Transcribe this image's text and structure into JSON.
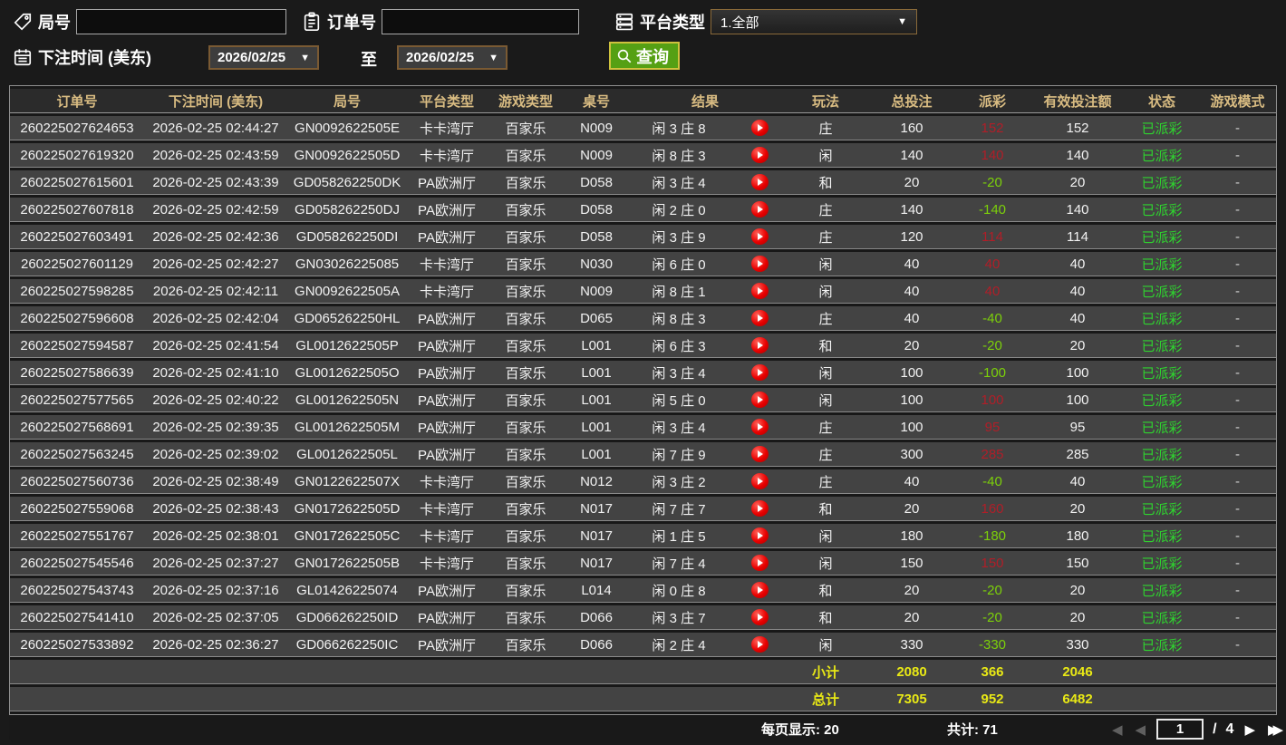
{
  "filters": {
    "game_no_label": "局号",
    "order_no_label": "订单号",
    "platform_label": "平台类型",
    "platform_value": "1.全部",
    "bet_time_label": "下注时间 (美东)",
    "date_from": "2026/02/25",
    "date_to": "2026/02/25",
    "to_label": "至",
    "search_label": "查询",
    "dropdown_arrow": "▼"
  },
  "table": {
    "headers": [
      "订单号",
      "下注时间 (美东)",
      "局号",
      "平台类型",
      "游戏类型",
      "桌号",
      "结果",
      "玩法",
      "总投注",
      "派彩",
      "有效投注额",
      "状态",
      "游戏模式"
    ],
    "rows": [
      {
        "order_no": "260225027624653",
        "bet_time": "2026-02-25 02:44:27",
        "game_no": "GN0092622505E",
        "platform": "卡卡湾厅",
        "game_type": "百家乐",
        "table_no": "N009",
        "result": "闲 3 庄 8",
        "method": "庄",
        "total_bet": "160",
        "payout": "152",
        "valid_bet": "152",
        "status": "已派彩",
        "mode": "-"
      },
      {
        "order_no": "260225027619320",
        "bet_time": "2026-02-25 02:43:59",
        "game_no": "GN0092622505D",
        "platform": "卡卡湾厅",
        "game_type": "百家乐",
        "table_no": "N009",
        "result": "闲 8 庄 3",
        "method": "闲",
        "total_bet": "140",
        "payout": "140",
        "valid_bet": "140",
        "status": "已派彩",
        "mode": "-"
      },
      {
        "order_no": "260225027615601",
        "bet_time": "2026-02-25 02:43:39",
        "game_no": "GD058262250DK",
        "platform": "PA欧洲厅",
        "game_type": "百家乐",
        "table_no": "D058",
        "result": "闲 3 庄 4",
        "method": "和",
        "total_bet": "20",
        "payout": "-20",
        "valid_bet": "20",
        "status": "已派彩",
        "mode": "-"
      },
      {
        "order_no": "260225027607818",
        "bet_time": "2026-02-25 02:42:59",
        "game_no": "GD058262250DJ",
        "platform": "PA欧洲厅",
        "game_type": "百家乐",
        "table_no": "D058",
        "result": "闲 2 庄 0",
        "method": "庄",
        "total_bet": "140",
        "payout": "-140",
        "valid_bet": "140",
        "status": "已派彩",
        "mode": "-"
      },
      {
        "order_no": "260225027603491",
        "bet_time": "2026-02-25 02:42:36",
        "game_no": "GD058262250DI",
        "platform": "PA欧洲厅",
        "game_type": "百家乐",
        "table_no": "D058",
        "result": "闲 3 庄 9",
        "method": "庄",
        "total_bet": "120",
        "payout": "114",
        "valid_bet": "114",
        "status": "已派彩",
        "mode": "-"
      },
      {
        "order_no": "260225027601129",
        "bet_time": "2026-02-25 02:42:27",
        "game_no": "GN03026225085",
        "platform": "卡卡湾厅",
        "game_type": "百家乐",
        "table_no": "N030",
        "result": "闲 6 庄 0",
        "method": "闲",
        "total_bet": "40",
        "payout": "40",
        "valid_bet": "40",
        "status": "已派彩",
        "mode": "-"
      },
      {
        "order_no": "260225027598285",
        "bet_time": "2026-02-25 02:42:11",
        "game_no": "GN0092622505A",
        "platform": "卡卡湾厅",
        "game_type": "百家乐",
        "table_no": "N009",
        "result": "闲 8 庄 1",
        "method": "闲",
        "total_bet": "40",
        "payout": "40",
        "valid_bet": "40",
        "status": "已派彩",
        "mode": "-"
      },
      {
        "order_no": "260225027596608",
        "bet_time": "2026-02-25 02:42:04",
        "game_no": "GD065262250HL",
        "platform": "PA欧洲厅",
        "game_type": "百家乐",
        "table_no": "D065",
        "result": "闲 8 庄 3",
        "method": "庄",
        "total_bet": "40",
        "payout": "-40",
        "valid_bet": "40",
        "status": "已派彩",
        "mode": "-"
      },
      {
        "order_no": "260225027594587",
        "bet_time": "2026-02-25 02:41:54",
        "game_no": "GL0012622505P",
        "platform": "PA欧洲厅",
        "game_type": "百家乐",
        "table_no": "L001",
        "result": "闲 6 庄 3",
        "method": "和",
        "total_bet": "20",
        "payout": "-20",
        "valid_bet": "20",
        "status": "已派彩",
        "mode": "-"
      },
      {
        "order_no": "260225027586639",
        "bet_time": "2026-02-25 02:41:10",
        "game_no": "GL0012622505O",
        "platform": "PA欧洲厅",
        "game_type": "百家乐",
        "table_no": "L001",
        "result": "闲 3 庄 4",
        "method": "闲",
        "total_bet": "100",
        "payout": "-100",
        "valid_bet": "100",
        "status": "已派彩",
        "mode": "-"
      },
      {
        "order_no": "260225027577565",
        "bet_time": "2026-02-25 02:40:22",
        "game_no": "GL0012622505N",
        "platform": "PA欧洲厅",
        "game_type": "百家乐",
        "table_no": "L001",
        "result": "闲 5 庄 0",
        "method": "闲",
        "total_bet": "100",
        "payout": "100",
        "valid_bet": "100",
        "status": "已派彩",
        "mode": "-"
      },
      {
        "order_no": "260225027568691",
        "bet_time": "2026-02-25 02:39:35",
        "game_no": "GL0012622505M",
        "platform": "PA欧洲厅",
        "game_type": "百家乐",
        "table_no": "L001",
        "result": "闲 3 庄 4",
        "method": "庄",
        "total_bet": "100",
        "payout": "95",
        "valid_bet": "95",
        "status": "已派彩",
        "mode": "-"
      },
      {
        "order_no": "260225027563245",
        "bet_time": "2026-02-25 02:39:02",
        "game_no": "GL0012622505L",
        "platform": "PA欧洲厅",
        "game_type": "百家乐",
        "table_no": "L001",
        "result": "闲 7 庄 9",
        "method": "庄",
        "total_bet": "300",
        "payout": "285",
        "valid_bet": "285",
        "status": "已派彩",
        "mode": "-"
      },
      {
        "order_no": "260225027560736",
        "bet_time": "2026-02-25 02:38:49",
        "game_no": "GN0122622507X",
        "platform": "卡卡湾厅",
        "game_type": "百家乐",
        "table_no": "N012",
        "result": "闲 3 庄 2",
        "method": "庄",
        "total_bet": "40",
        "payout": "-40",
        "valid_bet": "40",
        "status": "已派彩",
        "mode": "-"
      },
      {
        "order_no": "260225027559068",
        "bet_time": "2026-02-25 02:38:43",
        "game_no": "GN0172622505D",
        "platform": "卡卡湾厅",
        "game_type": "百家乐",
        "table_no": "N017",
        "result": "闲 7 庄 7",
        "method": "和",
        "total_bet": "20",
        "payout": "160",
        "valid_bet": "20",
        "status": "已派彩",
        "mode": "-"
      },
      {
        "order_no": "260225027551767",
        "bet_time": "2026-02-25 02:38:01",
        "game_no": "GN0172622505C",
        "platform": "卡卡湾厅",
        "game_type": "百家乐",
        "table_no": "N017",
        "result": "闲 1 庄 5",
        "method": "闲",
        "total_bet": "180",
        "payout": "-180",
        "valid_bet": "180",
        "status": "已派彩",
        "mode": "-"
      },
      {
        "order_no": "260225027545546",
        "bet_time": "2026-02-25 02:37:27",
        "game_no": "GN0172622505B",
        "platform": "卡卡湾厅",
        "game_type": "百家乐",
        "table_no": "N017",
        "result": "闲 7 庄 4",
        "method": "闲",
        "total_bet": "150",
        "payout": "150",
        "valid_bet": "150",
        "status": "已派彩",
        "mode": "-"
      },
      {
        "order_no": "260225027543743",
        "bet_time": "2026-02-25 02:37:16",
        "game_no": "GL01426225074",
        "platform": "PA欧洲厅",
        "game_type": "百家乐",
        "table_no": "L014",
        "result": "闲 0 庄 8",
        "method": "和",
        "total_bet": "20",
        "payout": "-20",
        "valid_bet": "20",
        "status": "已派彩",
        "mode": "-"
      },
      {
        "order_no": "260225027541410",
        "bet_time": "2026-02-25 02:37:05",
        "game_no": "GD066262250ID",
        "platform": "PA欧洲厅",
        "game_type": "百家乐",
        "table_no": "D066",
        "result": "闲 3 庄 7",
        "method": "和",
        "total_bet": "20",
        "payout": "-20",
        "valid_bet": "20",
        "status": "已派彩",
        "mode": "-"
      },
      {
        "order_no": "260225027533892",
        "bet_time": "2026-02-25 02:36:27",
        "game_no": "GD066262250IC",
        "platform": "PA欧洲厅",
        "game_type": "百家乐",
        "table_no": "D066",
        "result": "闲 2 庄 4",
        "method": "闲",
        "total_bet": "330",
        "payout": "-330",
        "valid_bet": "330",
        "status": "已派彩",
        "mode": "-"
      }
    ],
    "subtotal": {
      "label": "小计",
      "total_bet": "2080",
      "payout": "366",
      "valid_bet": "2046"
    },
    "total": {
      "label": "总计",
      "total_bet": "7305",
      "payout": "952",
      "valid_bet": "6482"
    }
  },
  "footer": {
    "per_page_label": "每页显示: 20",
    "total_count_label": "共计: 71",
    "first_icon": "◀",
    "prev_icon": "◀",
    "next_icon": "▶",
    "last_icon": "▶▶",
    "page": "1",
    "page_divider": "/",
    "total_pages": "4"
  },
  "colors": {
    "payout_positive": "#b01e28",
    "payout_negative": "#7cd00a",
    "status_green": "#2fd32f",
    "summary_yellow": "#e9e915",
    "header_gold": "#d9bc82",
    "search_button_green": "#55a014"
  }
}
